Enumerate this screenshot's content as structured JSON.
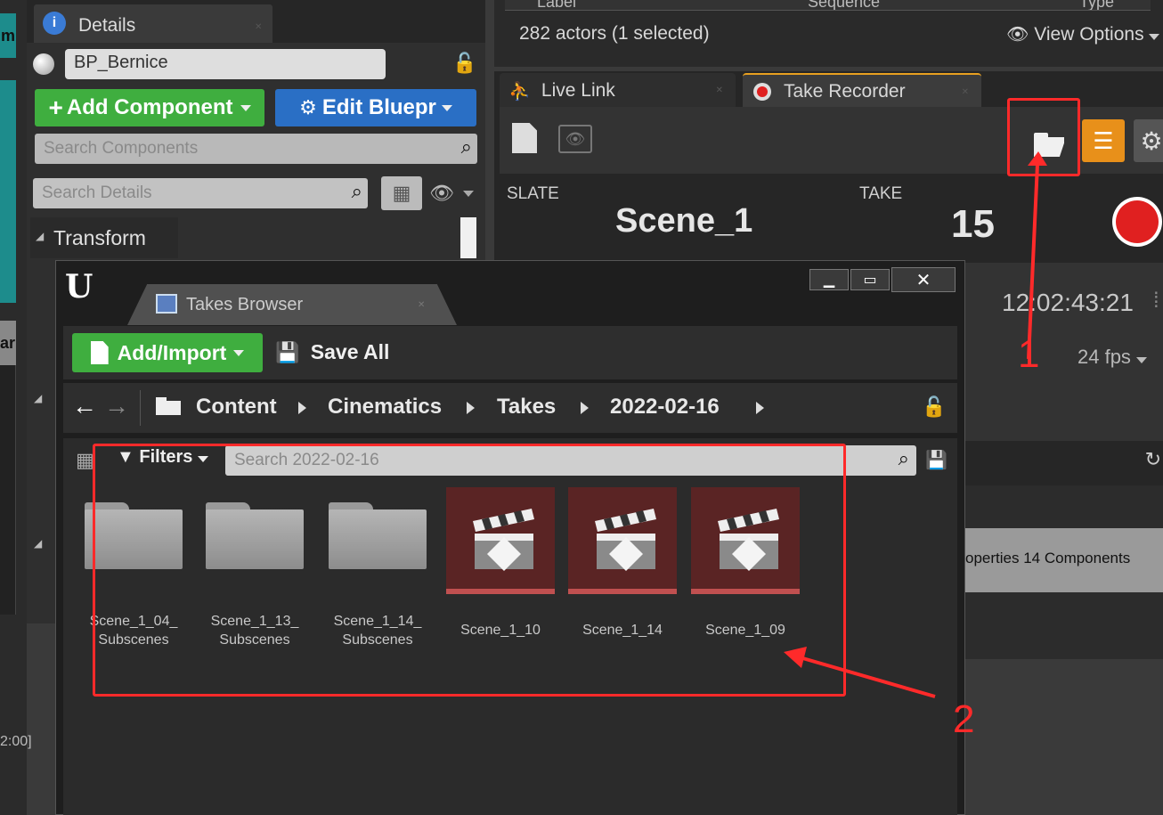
{
  "details": {
    "tab_title": "Details",
    "actor_name": "BP_Bernice",
    "add_component_label": "Add Component",
    "edit_blueprint_label": "Edit Bluepr",
    "search_components_placeholder": "Search Components",
    "search_details_placeholder": "Search Details",
    "transform_label": "Transform"
  },
  "outliner": {
    "columns": [
      "Label",
      "Sequence",
      "Type"
    ],
    "status": "282 actors (1 selected)",
    "view_options_label": "View Options"
  },
  "take_recorder": {
    "tabs": [
      {
        "label": "Live Link"
      },
      {
        "label": "Take Recorder"
      }
    ],
    "slate_label": "SLATE",
    "slate_value": "Scene_1",
    "take_label": "TAKE",
    "take_value": "15",
    "timecode": "12:02:43:21",
    "fps": "24 fps"
  },
  "takes_browser": {
    "tab_title": "Takes Browser",
    "add_import_label": "Add/Import",
    "save_all_label": "Save All",
    "breadcrumb": [
      "Content",
      "Cinematics",
      "Takes",
      "2022-02-16"
    ],
    "filters_label": "Filters",
    "search_placeholder": "Search 2022-02-16",
    "items": [
      {
        "type": "folder",
        "label_line1": "Scene_1_04_",
        "label_line2": "Subscenes"
      },
      {
        "type": "folder",
        "label_line1": "Scene_1_13_",
        "label_line2": "Subscenes"
      },
      {
        "type": "folder",
        "label_line1": "Scene_1_14_",
        "label_line2": "Subscenes"
      },
      {
        "type": "level-sequence",
        "label": "Scene_1_10"
      },
      {
        "type": "level-sequence",
        "label": "Scene_1_14"
      },
      {
        "type": "level-sequence",
        "label": "Scene_1_09"
      }
    ]
  },
  "misc": {
    "properties_text": "operties 14 Components",
    "left_time_text": "2:00]",
    "left_letter_top": "m",
    "left_letter_mid": "ar"
  },
  "annotations": {
    "marker_1": "1",
    "marker_2": "2"
  },
  "colors": {
    "accent_green": "#3fae3f",
    "accent_blue": "#2a6fc5",
    "record_red": "#e02020",
    "annotation_red": "#ff2a2a",
    "orange_button": "#e8901a"
  }
}
